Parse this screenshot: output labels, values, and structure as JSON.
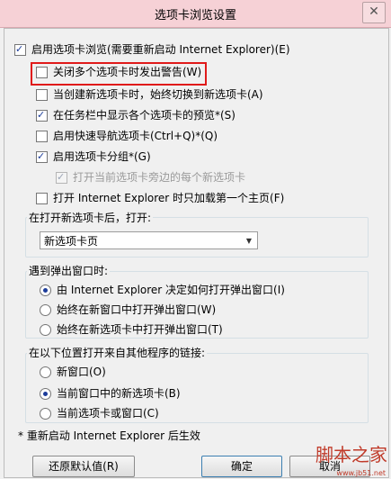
{
  "window": {
    "title": "选项卡浏览设置",
    "close_glyph": "✕"
  },
  "options": {
    "enable_tabs": {
      "label": "启用选项卡浏览(需要重新启动 Internet Explorer)(E)",
      "checked": true
    },
    "warn_close": {
      "label": "关闭多个选项卡时发出警告(W)",
      "checked": false
    },
    "switch_new": {
      "label": "当创建新选项卡时，始终切换到新选项卡(A)",
      "checked": false
    },
    "taskbar_preview": {
      "label": "在任务栏中显示各个选项卡的预览*(S)",
      "checked": true
    },
    "quick_nav": {
      "label": "启用快速导航选项卡(Ctrl+Q)*(Q)",
      "checked": false
    },
    "tab_groups": {
      "label": "启用选项卡分组*(G)",
      "checked": true
    },
    "open_next": {
      "label": "打开当前选项卡旁边的每个新选项卡",
      "checked": true,
      "disabled": true
    },
    "first_home": {
      "label": "打开 Internet Explorer 时只加载第一个主页(F)",
      "checked": false
    }
  },
  "new_tab": {
    "label": "在打开新选项卡后，打开:",
    "selected": "新选项卡页"
  },
  "popups": {
    "label": "遇到弹出窗口时:",
    "items": [
      {
        "label": "由 Internet Explorer 决定如何打开弹出窗口(I)",
        "checked": true
      },
      {
        "label": "始终在新窗口中打开弹出窗口(W)",
        "checked": false
      },
      {
        "label": "始终在新选项卡中打开弹出窗口(T)",
        "checked": false
      }
    ]
  },
  "links": {
    "label": "在以下位置打开来自其他程序的链接:",
    "items": [
      {
        "label": "新窗口(O)",
        "checked": false
      },
      {
        "label": "当前窗口中的新选项卡(B)",
        "checked": true
      },
      {
        "label": "当前选项卡或窗口(C)",
        "checked": false
      }
    ]
  },
  "footnote": "* 重新启动 Internet Explorer 后生效",
  "buttons": {
    "restore": "还原默认值(R)",
    "ok": "确定",
    "cancel": "取消"
  },
  "watermark": {
    "text": "脚本之家",
    "url": "www.jb51.net"
  }
}
